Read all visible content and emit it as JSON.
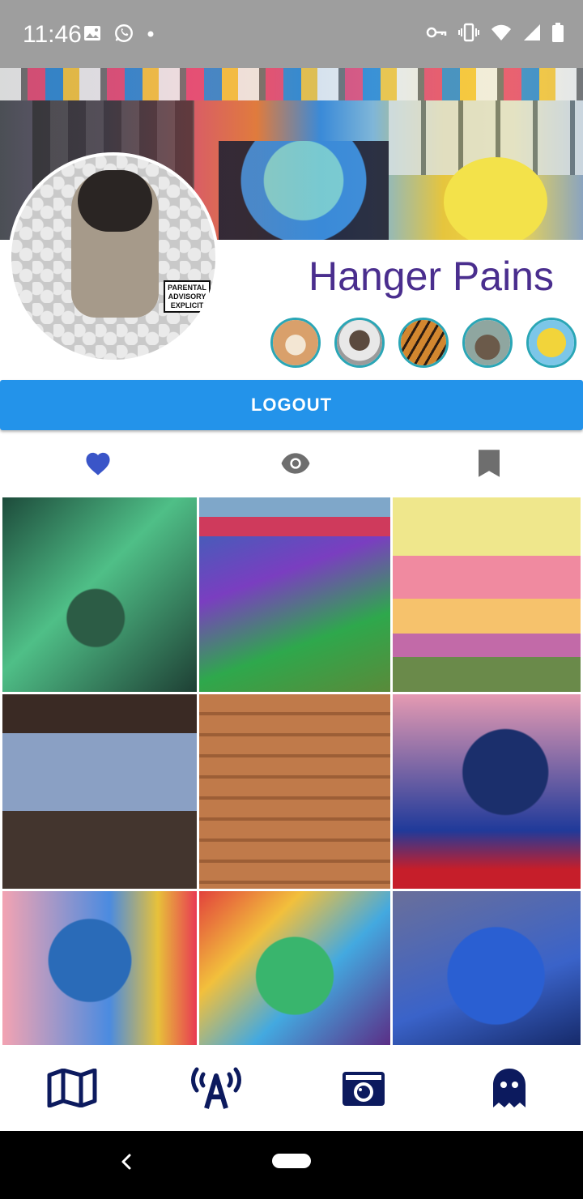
{
  "status_bar": {
    "time": "11:46",
    "left_icons": [
      "image-icon",
      "whatsapp-icon",
      "dot-icon"
    ],
    "right_icons": [
      "key-icon",
      "vibrate-icon",
      "wifi-icon",
      "signal-icon",
      "battery-icon"
    ]
  },
  "profile": {
    "name": "Hanger Pains",
    "avatar_label": "pug-avatar",
    "advisory_text": "PARENTAL ADVISORY EXPLICIT CONTENT"
  },
  "friends": [
    {
      "name": "shiba-avatar",
      "color": "#d9a06b"
    },
    {
      "name": "man-avatar",
      "color": "#5b4a3e"
    },
    {
      "name": "tiger-avatar",
      "color": "#d2872f"
    },
    {
      "name": "animal-avatar",
      "color": "#6b5a4a"
    },
    {
      "name": "cartoon-avatar",
      "color": "#f2d43a"
    }
  ],
  "logout": {
    "label": "LOGOUT"
  },
  "tabs": [
    {
      "name": "heart-icon",
      "color": "#3a55c8"
    },
    {
      "name": "eye-icon",
      "color": "#6e6e6e"
    },
    {
      "name": "bookmark-icon",
      "color": "#6e6e6e"
    }
  ],
  "gallery": [
    {
      "name": "green-creature-mural"
    },
    {
      "name": "graffiti-wall-mural"
    },
    {
      "name": "rose-bomb-mural"
    },
    {
      "name": "grey-tag-mural"
    },
    {
      "name": "brick-hand-mural"
    },
    {
      "name": "blue-portrait-mural"
    },
    {
      "name": "blue-woman-mural"
    },
    {
      "name": "colorful-face-mural"
    },
    {
      "name": "blue-beast-mural"
    }
  ],
  "bottom_nav": [
    {
      "name": "map-icon"
    },
    {
      "name": "antenna-icon"
    },
    {
      "name": "camera-icon"
    },
    {
      "name": "ghost-icon"
    }
  ],
  "colors": {
    "accent": "#2393ea",
    "name": "#4a2e8e",
    "nav_icon": "#0c1a5e",
    "friend_ring": "#2aa6b6"
  }
}
